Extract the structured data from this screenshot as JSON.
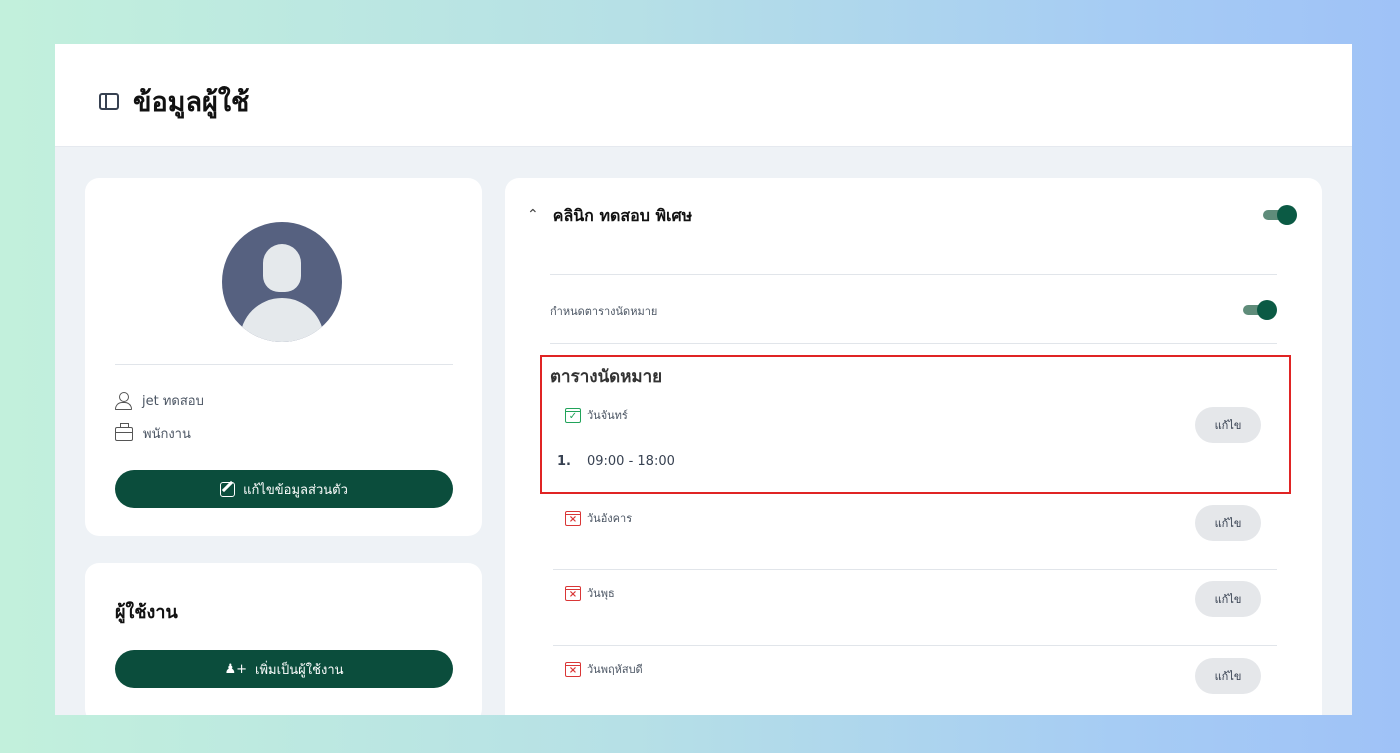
{
  "header": {
    "title": "ข้อมูลผู้ใช้",
    "sidebar_icon": "sidebar-icon"
  },
  "profile": {
    "name": "jet ทดสอบ",
    "role": "พนักงาน",
    "edit_label": "แก้ไขข้อมูลส่วนตัว"
  },
  "users": {
    "title": "ผู้ใช้งาน",
    "add_label": "เพิ่มเป็นผู้ใช้งาน"
  },
  "clinic": {
    "name": "คลินิก ทดสอบ พิเศษ",
    "enabled": true,
    "schedule_setting_label": "กำหนดตารางนัดหมาย",
    "schedule_enabled": true,
    "schedule_title": "ตารางนัดหมาย",
    "edit_label": "แก้ไข",
    "days": [
      {
        "label": "วันจันทร์",
        "active": true,
        "slots": [
          {
            "index": "1.",
            "time": "09:00 - 18:00"
          }
        ]
      },
      {
        "label": "วันอังคาร",
        "active": false,
        "slots": []
      },
      {
        "label": "วันพุธ",
        "active": false,
        "slots": []
      },
      {
        "label": "วันพฤหัสบดี",
        "active": false,
        "slots": []
      }
    ]
  },
  "colors": {
    "primary_green": "#0b4d3c",
    "active_green": "#21a35a",
    "inactive_red": "#d93636",
    "highlight_red": "#e02424"
  }
}
